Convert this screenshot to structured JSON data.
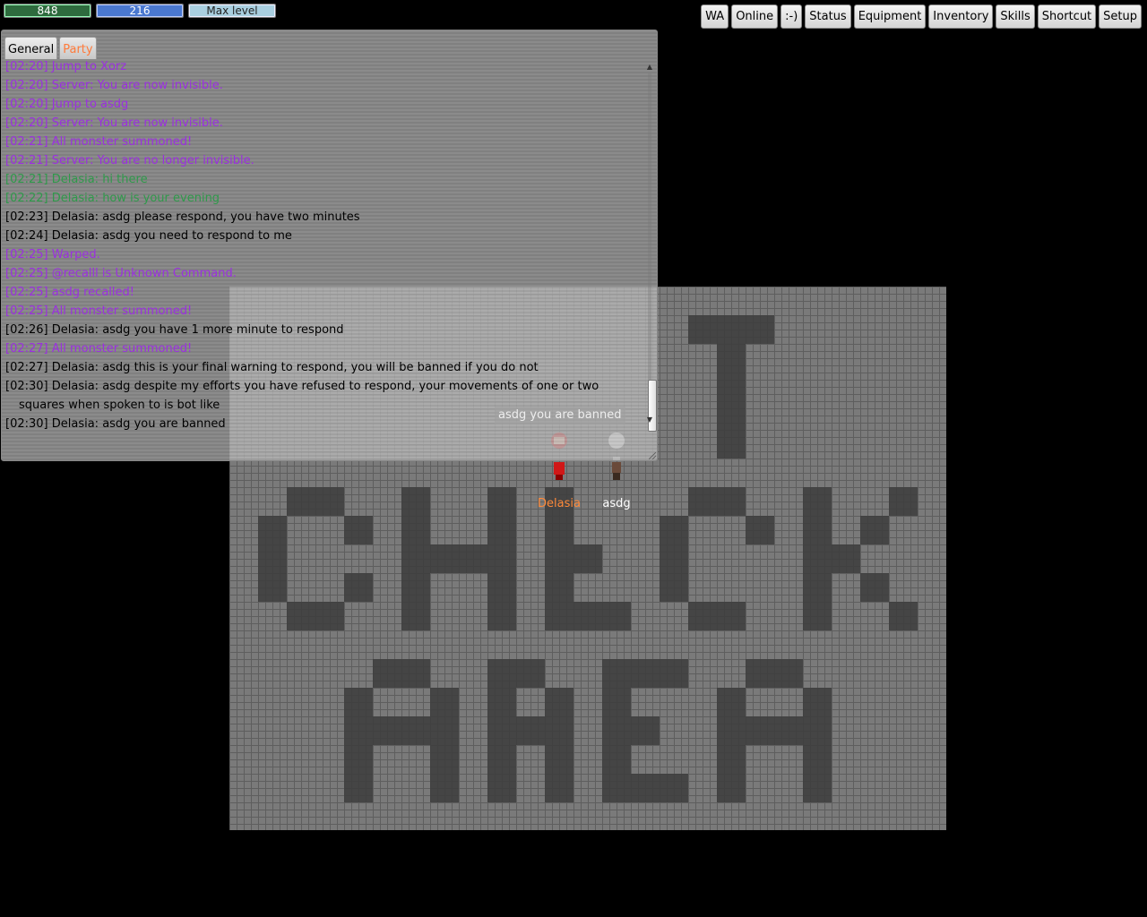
{
  "status": {
    "hp": "848",
    "mp": "216",
    "xp": "Max level"
  },
  "menu": [
    "WA",
    "Online",
    ":-)",
    "Status",
    "Equipment",
    "Inventory",
    "Skills",
    "Shortcut",
    "Setup"
  ],
  "chat": {
    "tabs": [
      "General",
      "Party"
    ],
    "lines": [
      {
        "text": "[02:20] Jump to Xorz",
        "color": "#9b2fe0"
      },
      {
        "text": "[02:20] Server: You are now invisible.",
        "color": "#9b2fe0"
      },
      {
        "text": "[02:20] Jump to asdg",
        "color": "#9b2fe0"
      },
      {
        "text": "[02:20] Server: You are now invisible.",
        "color": "#9b2fe0"
      },
      {
        "text": "[02:21] All monster summoned!",
        "color": "#9b2fe0"
      },
      {
        "text": "[02:21] Server: You are no longer invisible.",
        "color": "#9b2fe0"
      },
      {
        "text": "[02:21] Delasia: hi there",
        "color": "#2e9a4a"
      },
      {
        "text": "[02:22] Delasia: how is your evening",
        "color": "#2e9a4a"
      },
      {
        "text": "[02:23] Delasia: asdg please respond, you have two minutes",
        "color": "#000000"
      },
      {
        "text": "[02:24] Delasia: asdg you need to respond to me",
        "color": "#000000"
      },
      {
        "text": "[02:25] Warped.",
        "color": "#9b2fe0"
      },
      {
        "text": "[02:25] @recalll is Unknown Command.",
        "color": "#9b2fe0"
      },
      {
        "text": "[02:25] asdg recalled!",
        "color": "#9b2fe0"
      },
      {
        "text": "[02:25] All monster summoned!",
        "color": "#9b2fe0"
      },
      {
        "text": "[02:26] Delasia: asdg you have 1 more minute to respond",
        "color": "#000000"
      },
      {
        "text": "[02:27] All monster summoned!",
        "color": "#9b2fe0"
      },
      {
        "text": "[02:27] Delasia: asdg this is your final warning to respond, you will be banned if you do not",
        "color": "#000000"
      },
      {
        "text": "[02:30] Delasia: asdg despite my efforts you have refused to respond, your movements of one or two squares when spoken to is bot like",
        "color": "#000000"
      },
      {
        "text": "[02:30] Delasia: asdg you are banned",
        "color": "#000000"
      }
    ]
  },
  "scene": {
    "bubble": "asdg you are banned",
    "characters": {
      "delasia": "Delasia",
      "asdg": "asdg"
    }
  }
}
